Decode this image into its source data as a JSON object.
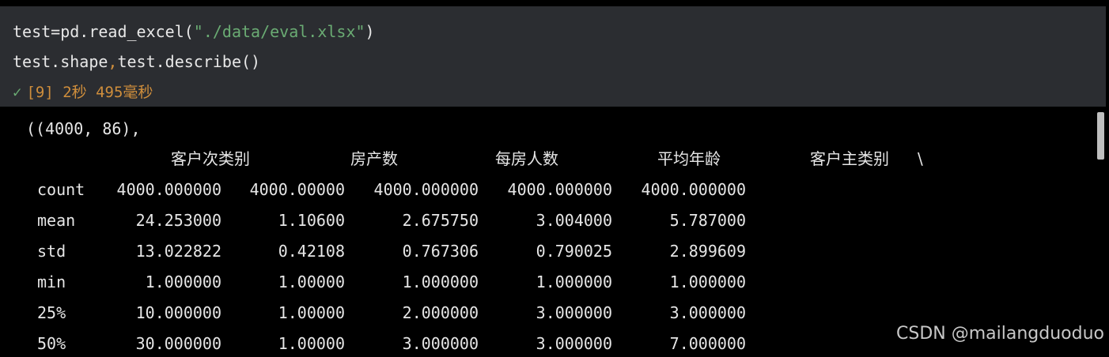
{
  "cell": {
    "code_line1_prefix": "test=pd.read_excel(",
    "code_line1_string": "\"./data/eval.xlsx\"",
    "code_line1_suffix": ")",
    "code_line2_part1": "test.shape",
    "code_line2_comma": ",",
    "code_line2_part2": "test.describe()",
    "status_check": "✓",
    "status_text": "[9] 2秒 495毫秒"
  },
  "output": {
    "first_line": "((4000, 86),",
    "columns": [
      "客户次类别",
      "房产数",
      "每房人数",
      "平均年龄",
      "客户主类别"
    ],
    "continuation": "\\",
    "rows": [
      {
        "label": "count",
        "values": [
          "4000.000000",
          "4000.00000",
          "4000.000000",
          "4000.000000",
          "4000.000000"
        ]
      },
      {
        "label": "mean",
        "values": [
          "24.253000",
          "1.10600",
          "2.675750",
          "3.004000",
          "5.787000"
        ]
      },
      {
        "label": "std",
        "values": [
          "13.022822",
          "0.42108",
          "0.767306",
          "0.790025",
          "2.899609"
        ]
      },
      {
        "label": "min",
        "values": [
          "1.000000",
          "1.00000",
          "1.000000",
          "1.000000",
          "1.000000"
        ]
      },
      {
        "label": "25%",
        "values": [
          "10.000000",
          "1.00000",
          "2.000000",
          "3.000000",
          "3.000000"
        ]
      },
      {
        "label": "50%",
        "values": [
          "30.000000",
          "1.00000",
          "3.000000",
          "3.000000",
          "7.000000"
        ]
      }
    ]
  },
  "watermark": "CSDN @mailangduoduo"
}
